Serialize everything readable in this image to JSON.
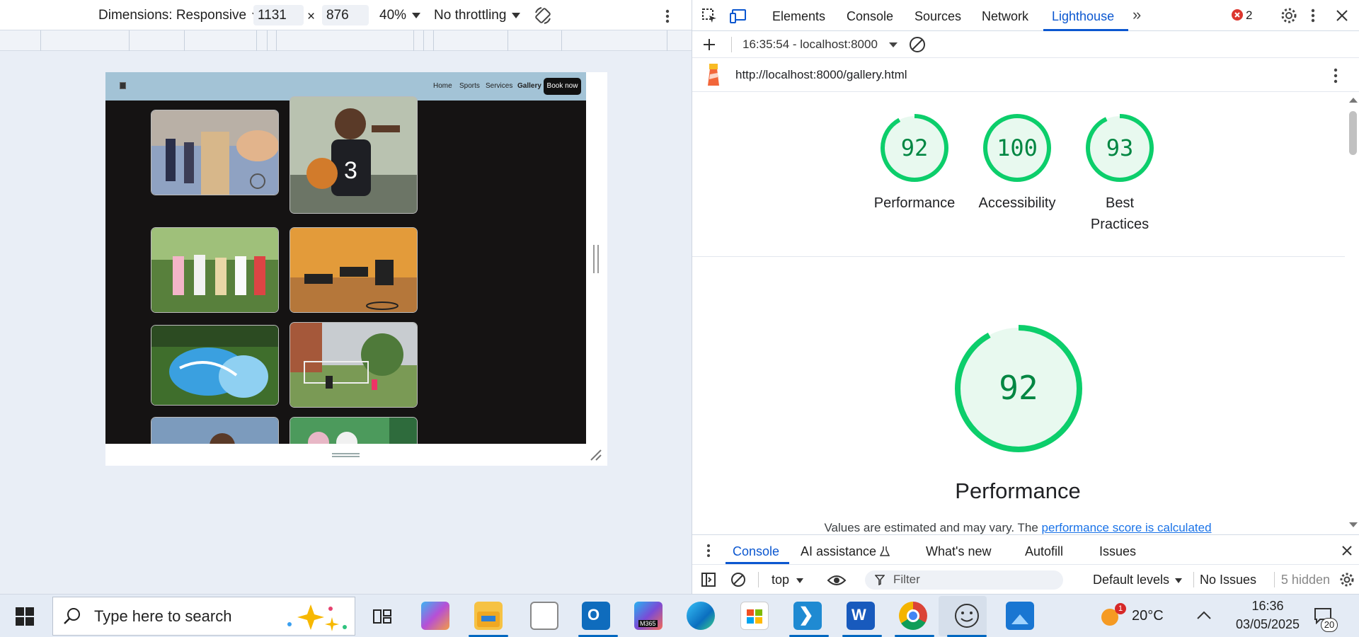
{
  "device_toolbar": {
    "dimensions_label": "Dimensions: Responsive",
    "width": "1131",
    "times": "×",
    "height": "876",
    "zoom": "40%",
    "throttling": "No throttling"
  },
  "website": {
    "nav": [
      "Home",
      "Sports",
      "Services",
      "Gallery"
    ],
    "active_nav": "Gallery",
    "cta": "Book now"
  },
  "devtools": {
    "tabs": [
      "Elements",
      "Console",
      "Sources",
      "Network",
      "Lighthouse"
    ],
    "active_tab": "Lighthouse",
    "error_count": "2",
    "report_time": "16:35:54 - localhost:8000",
    "url": "http://localhost:8000/gallery.html",
    "scores": [
      {
        "label": "Performance",
        "value": "92"
      },
      {
        "label": "Accessibility",
        "value": "100"
      },
      {
        "label": "Best Practices",
        "value": "93"
      }
    ],
    "main_score": "92",
    "main_title": "Performance",
    "values_text": "Values are estimated and may vary. The ",
    "values_link": "performance score is calculated",
    "score_color": "#0cce6b",
    "score_text_color": "#018642"
  },
  "drawer": {
    "tabs": [
      "Console",
      "AI assistance",
      "What's new",
      "Autofill",
      "Issues"
    ],
    "active_tab": "Console",
    "context": "top",
    "filter_placeholder": "Filter",
    "levels": "Default levels",
    "issues": "No Issues",
    "hidden": "5 hidden"
  },
  "taskbar": {
    "search_placeholder": "Type here to search",
    "weather": "20°C",
    "weather_badge": "1",
    "time": "16:36",
    "date": "03/05/2025",
    "notif_count": "20",
    "m365_label": "M365"
  }
}
